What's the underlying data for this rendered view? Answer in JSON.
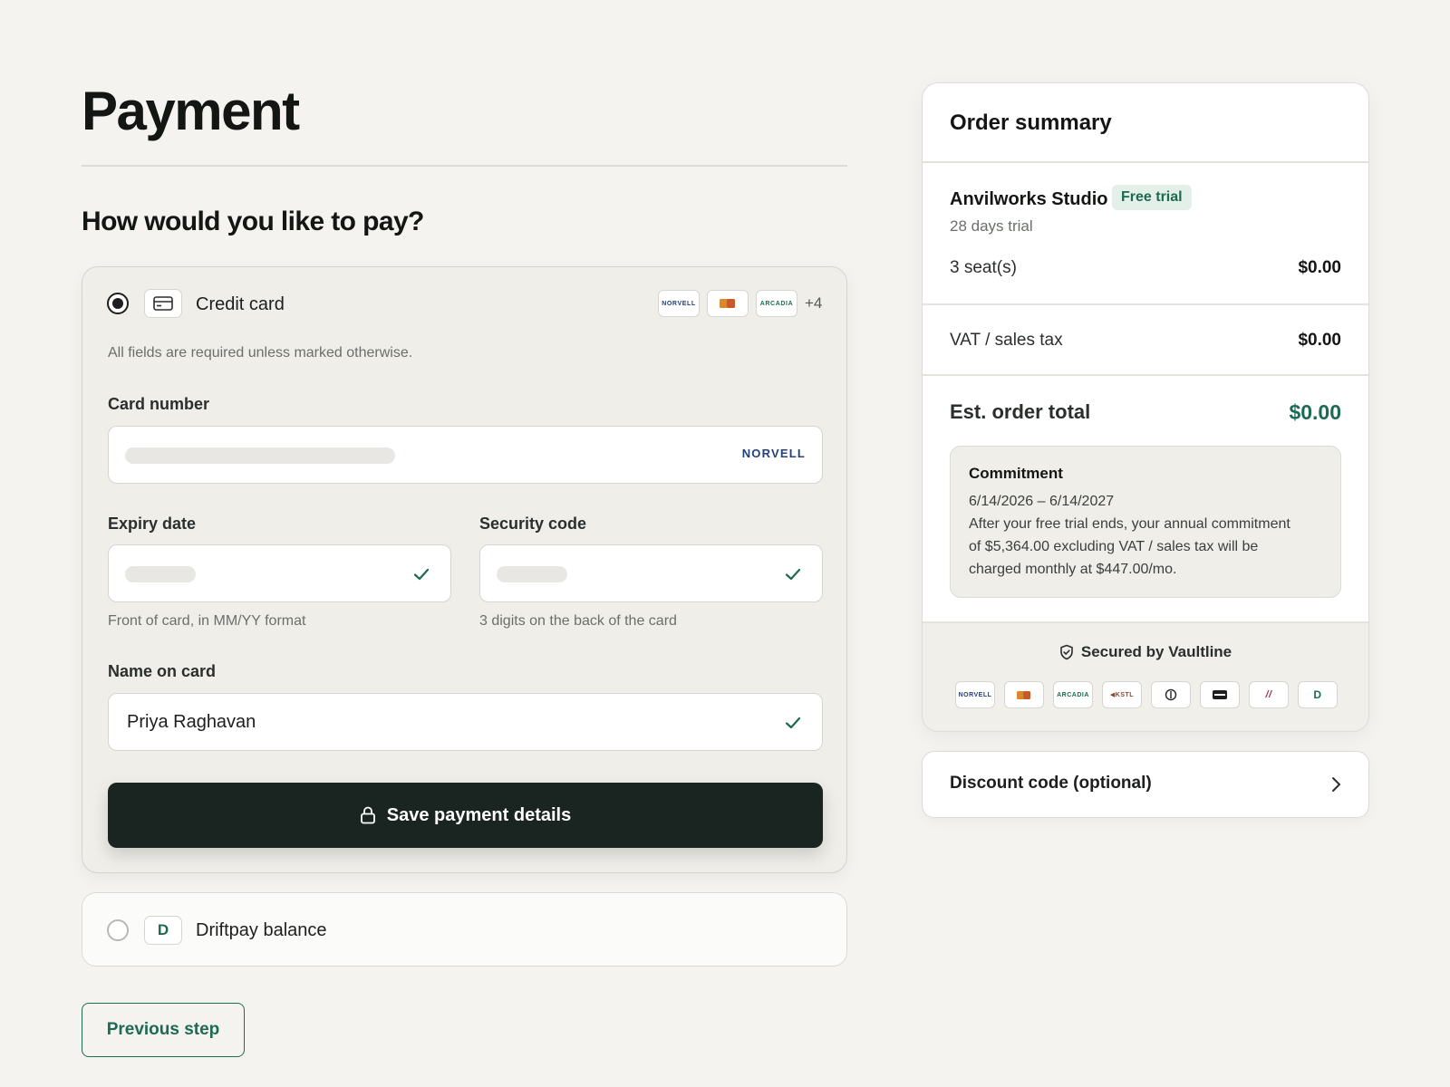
{
  "page": {
    "title": "Payment",
    "section_title": "How would you like to pay?"
  },
  "credit_card": {
    "label": "Credit card",
    "selected": true,
    "brands": [
      "NORVELL",
      "ARCADIA"
    ],
    "more_brands": "+4",
    "required_hint": "All fields are required unless marked otherwise.",
    "card_number": {
      "label": "Card number",
      "brand": "NORVELL"
    },
    "expiry": {
      "label": "Expiry date",
      "hint": "Front of card, in MM/YY format"
    },
    "security_code": {
      "label": "Security code",
      "hint": "3 digits on the back of the card"
    },
    "name": {
      "label": "Name on card",
      "value": "Priya Raghavan"
    },
    "save_button": "Save payment details"
  },
  "driftpay": {
    "label": "Driftpay balance",
    "icon_letter": "D",
    "selected": false
  },
  "previous_step": "Previous step",
  "order_summary": {
    "title": "Order summary",
    "product": "Anvilworks Studio",
    "badge": "Free trial",
    "trial_text": "28 days trial",
    "seats_label": "3 seat(s)",
    "seats_value": "$0.00",
    "tax_label": "VAT / sales tax",
    "tax_value": "$0.00",
    "total_label": "Est. order total",
    "total_value": "$0.00",
    "commitment": {
      "title": "Commitment",
      "dates": "6/14/2026 – 6/14/2027",
      "line1": "After your free trial ends, your annual commitment",
      "line2": "of $5,364.00 excluding VAT / sales tax will be",
      "line3": "charged monthly at $447.00/mo."
    },
    "secured_by": "Secured by Vaultline",
    "secure_brands": [
      "NORVELL",
      "ARCADIA",
      "KSTL",
      "//",
      "D"
    ]
  },
  "discount": {
    "label": "Discount code (optional)"
  },
  "colors": {
    "accent_green": "#1d6a52",
    "button_dark": "#1a2521",
    "brand_blue": "#24407a"
  }
}
